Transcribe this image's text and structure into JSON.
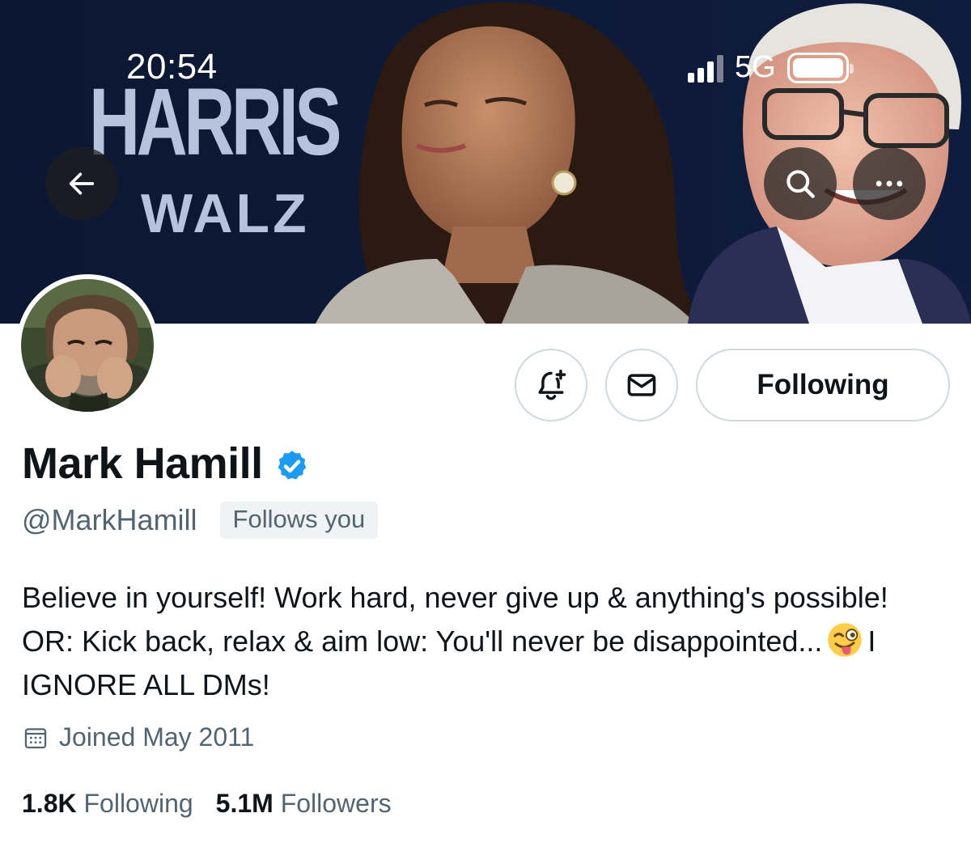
{
  "status_bar": {
    "time": "20:54",
    "network": "5G"
  },
  "banner": {
    "logo_line1": "HARRIS",
    "logo_line2": "WALZ",
    "bg_color": "#0e1a38",
    "logo_color": "#b7c2dc"
  },
  "nav": {
    "back_icon": "arrow-left-icon",
    "search_icon": "search-icon",
    "more_icon": "more-horizontal-icon"
  },
  "actions": {
    "notify_icon": "bell-plus-icon",
    "message_icon": "envelope-icon",
    "follow_label": "Following"
  },
  "profile": {
    "display_name": "Mark Hamill",
    "verified": true,
    "handle": "@MarkHamill",
    "follows_you_label": "Follows you",
    "bio_part1": "Believe in yourself! Work hard, never give up & anything's possible! OR: Kick back, relax & aim low: You'll never be disappointed...",
    "bio_emoji": "winking-face-with-tongue-emoji",
    "bio_part2": "I IGNORE ALL DMs!",
    "joined": "Joined May 2011",
    "following_count": "1.8K",
    "following_label": "Following",
    "followers_count": "5.1M",
    "followers_label": "Followers"
  },
  "colors": {
    "text_primary": "#0f1419",
    "text_secondary": "#536471",
    "verified_blue": "#1d9bf0",
    "border": "#cfd9de"
  }
}
